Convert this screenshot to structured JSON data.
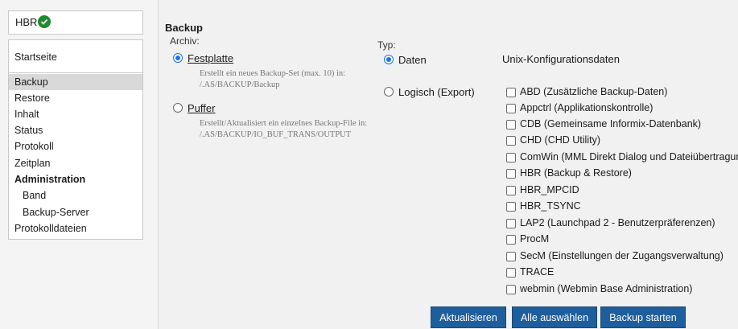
{
  "sidebar": {
    "app_label": "HBR",
    "status_icon": "check-circle-icon",
    "status_color": "#1f8a2e",
    "start_label": "Startseite",
    "items": [
      {
        "label": "Backup"
      },
      {
        "label": "Restore"
      },
      {
        "label": "Inhalt"
      },
      {
        "label": "Status"
      },
      {
        "label": "Protokoll"
      },
      {
        "label": "Zeitplan"
      },
      {
        "label": "Administration"
      },
      {
        "label": "Band"
      },
      {
        "label": "Backup-Server"
      },
      {
        "label": "Protokolldateien"
      }
    ]
  },
  "main": {
    "title": "Backup",
    "archiv_label": "Archiv:",
    "festplatte": {
      "label": "Festplatte",
      "desc_line1": "Erstellt ein neues Backup-Set (max. 10) in:",
      "desc_line2": "/.AS/BACKUP/Backup"
    },
    "puffer": {
      "label": "Puffer",
      "desc_line1": "Erstellt/Aktualisiert ein einzelnes Backup-File in:",
      "desc_line2": "/.AS/BACKUP/IO_BUF_TRANS/OUTPUT"
    },
    "typ_label": "Typ:",
    "daten_label": "Daten",
    "logisch_label": "Logisch (Export)",
    "unix_heading": "Unix-Konfigurationsdaten",
    "checkboxes": [
      {
        "label": "ABD (Zusätzliche Backup-Daten)"
      },
      {
        "label": "Appctrl (Applikationskontrolle)"
      },
      {
        "label": "CDB (Gemeinsame Informix-Datenbank)"
      },
      {
        "label": "CHD (CHD Utility)"
      },
      {
        "label": "ComWin (MML Direkt Dialog und Dateiübertragung)"
      },
      {
        "label": "HBR (Backup & Restore)"
      },
      {
        "label": "HBR_MPCID"
      },
      {
        "label": "HBR_TSYNC"
      },
      {
        "label": "LAP2 (Launchpad 2 - Benutzerpräferenzen)"
      },
      {
        "label": "ProcM"
      },
      {
        "label": "SecM (Einstellungen der Zugangsverwaltung)"
      },
      {
        "label": "TRACE"
      },
      {
        "label": "webmin (Webmin Base Administration)"
      }
    ],
    "buttons": {
      "update": "Aktualisieren",
      "select_all": "Alle auswählen",
      "start": "Backup starten"
    },
    "accent_color": "#1f5e9c"
  }
}
